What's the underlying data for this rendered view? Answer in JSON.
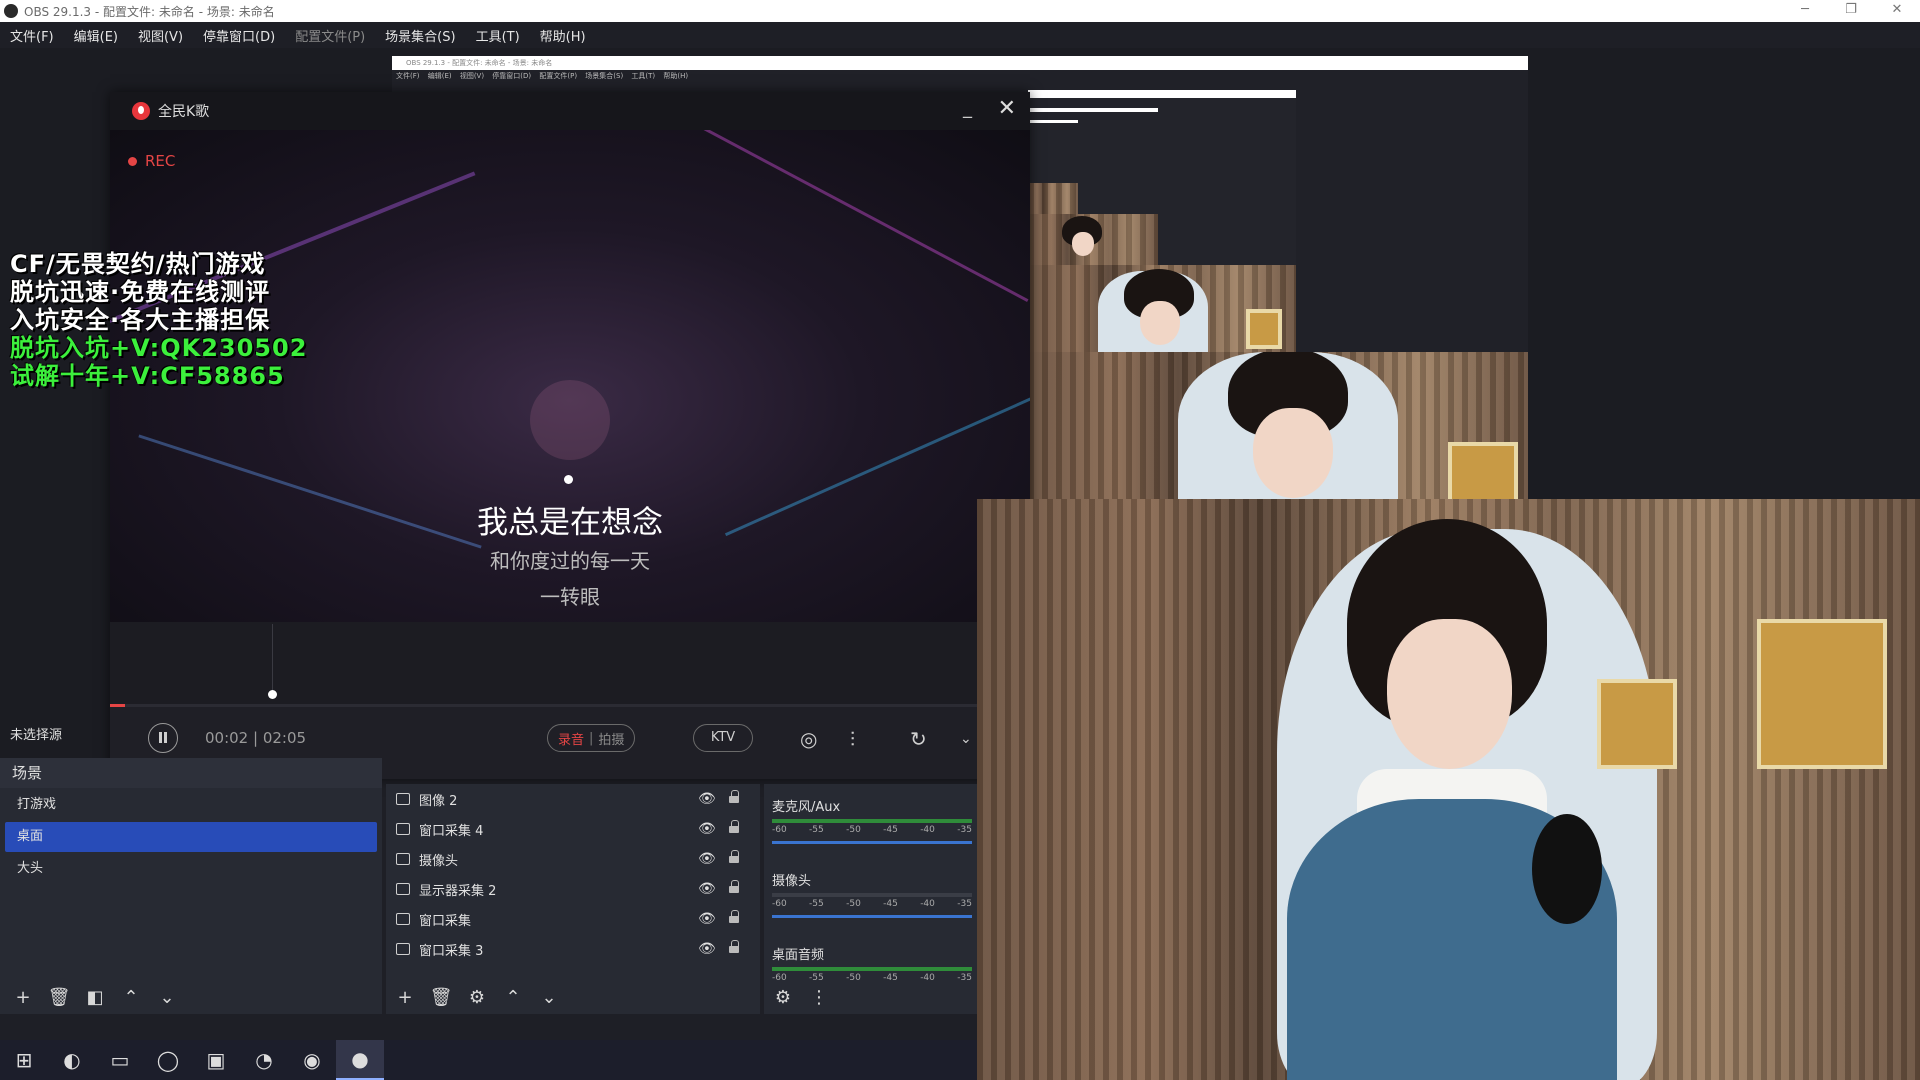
{
  "window": {
    "title": "OBS 29.1.3 - 配置文件: 未命名 - 场景: 未命名",
    "controls": [
      "─",
      "❐",
      "✕"
    ]
  },
  "menu": [
    "文件(F)",
    "编辑(E)",
    "视图(V)",
    "停靠窗口(D)",
    "配置文件(P)",
    "场景集合(S)",
    "工具(T)",
    "帮助(H)"
  ],
  "nested_preview": {
    "title": "OBS 29.1.3 - 配置文件: 未命名 - 场景: 未命名",
    "menu": "文件(F) 编辑(E) 视图(V) 停靠窗口(D) 配置文件(P) 场景集合(S) 工具(T) 帮助(H)"
  },
  "ktv": {
    "app_title": "全民K歌",
    "rec": "REC",
    "lyric_current": "我总是在想念",
    "lyric_next1": "和你度过的每一天",
    "lyric_next2": "一转眼",
    "time": "00:02 | 02:05",
    "mode_active": "录音",
    "mode_inactive": "拍摄",
    "ktv_button": "KTV",
    "wave_end": "0",
    "progress": 0.016
  },
  "ad_overlay": {
    "lines_white": [
      "CF/无畏契约/热门游戏",
      "脱坑迅速·免费在线测评",
      "入坑安全·各大主播担保"
    ],
    "lines_green": [
      "脱坑入坑+V:QK230502",
      "试解十年+V:CF58865"
    ]
  },
  "no_source_label": "未选择源",
  "scenes": {
    "title": "场景",
    "items": [
      "打游戏",
      "桌面",
      "大头"
    ],
    "selected": "桌面"
  },
  "sources": {
    "items": [
      "图像 2",
      "窗口采集 4",
      "摄像头",
      "显示器采集 2",
      "窗口采集",
      "窗口采集 3"
    ]
  },
  "mixer": {
    "channels": [
      "麦克风/Aux",
      "摄像头",
      "桌面音频"
    ],
    "ticks": [
      "-60",
      "-55",
      "-50",
      "-45",
      "-40",
      "-35"
    ]
  },
  "colors": {
    "accent": "#284cb8",
    "rec_red": "#e54545",
    "ad_green": "#3cf03c"
  },
  "icons": {
    "toolbar": [
      "plus-icon",
      "trash-icon",
      "filter-icon",
      "up-icon",
      "down-icon"
    ],
    "taskbar": [
      "windows-start-icon",
      "edge-icon",
      "terminal-icon",
      "obs-icon",
      "files-icon",
      "clock-icon",
      "netease-music-icon",
      "kge-icon"
    ]
  }
}
